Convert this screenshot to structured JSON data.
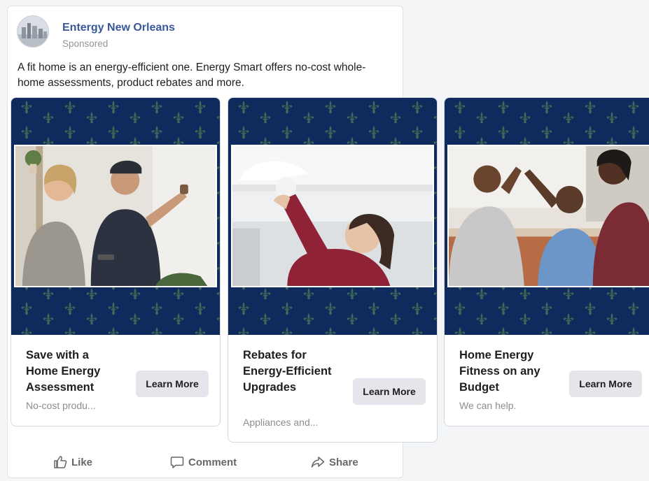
{
  "post": {
    "page_name": "Entergy New Orleans",
    "sponsored_label": "Sponsored",
    "caption": "A fit home is an energy-efficient one. Energy Smart offers no-cost whole-home assessments, product rebates and more."
  },
  "cards": [
    {
      "headline": "Save with a Home Energy Assessment",
      "description": "No-cost produ...",
      "cta_label": "Learn More"
    },
    {
      "headline": "Rebates for Energy-Efficient Upgrades",
      "description": "Appliances and...",
      "cta_label": "Learn More"
    },
    {
      "headline": "Home Energy Fitness on any Budget",
      "description": "We can help.",
      "cta_label": "Learn More"
    }
  ],
  "actions": {
    "like_label": "Like",
    "comment_label": "Comment",
    "share_label": "Share"
  },
  "colors": {
    "brand_link": "#385898",
    "banner_navy": "#0f2a5c",
    "pattern_green": "#3d6a57",
    "button_gray": "#e4e6eb"
  },
  "icons": [
    "avatar-city-logo",
    "thumbs-up-icon",
    "comment-bubble-icon",
    "share-arrow-icon",
    "fleur-de-lis-pattern"
  ]
}
